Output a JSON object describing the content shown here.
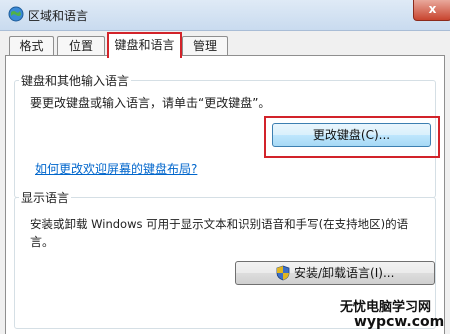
{
  "window": {
    "title": "区域和语言",
    "close_label": "x"
  },
  "tabs": [
    {
      "label": "格式"
    },
    {
      "label": "位置"
    },
    {
      "label": "键盘和语言"
    },
    {
      "label": "管理"
    }
  ],
  "keyboard_group": {
    "title": "键盘和其他输入语言",
    "description": "要更改键盘或输入语言，请单击“更改键盘”。",
    "change_keyboard_button": "更改键盘(C)...",
    "help_link": "如何更改欢迎屏幕的键盘布局?"
  },
  "display_group": {
    "title": "显示语言",
    "description_line1": "安装或卸载 Windows 可用于显示文本和识别语音和手写(在支持地区)的语",
    "description_line2": "言。",
    "install_button": "安装/卸载语言(I)..."
  },
  "watermark": {
    "line1": "无忧电脑学习网",
    "line2": "wypcw.com"
  },
  "icons": {
    "app": "globe-icon",
    "shield": "uac-shield-icon"
  }
}
